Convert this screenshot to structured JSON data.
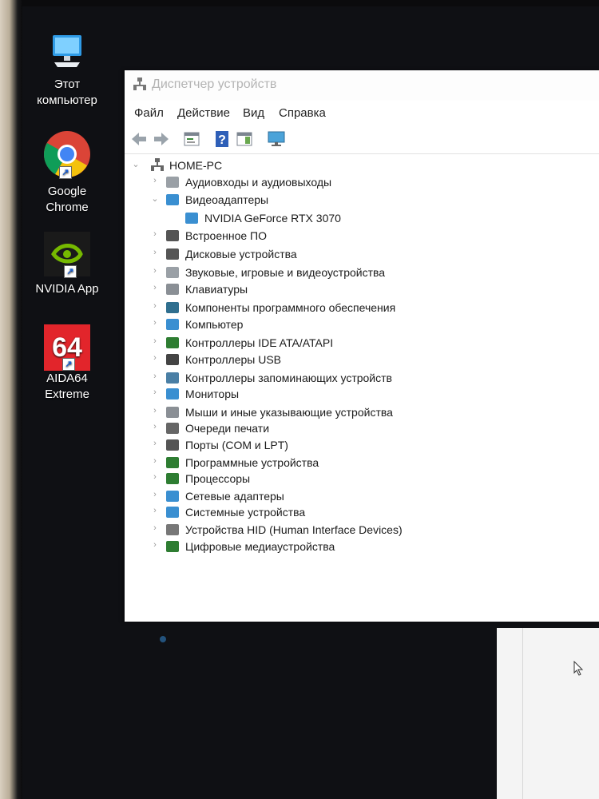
{
  "desktop": {
    "icons": [
      {
        "label1": "Этот",
        "label2": "компьютер"
      },
      {
        "label1": "Google",
        "label2": "Chrome"
      },
      {
        "label1": "NVIDIA App",
        "label2": ""
      },
      {
        "label1": "AIDA64",
        "label2": "Extreme",
        "logo_text": "64"
      }
    ]
  },
  "window": {
    "title": "Диспетчер устройств",
    "menu": [
      "Файл",
      "Действие",
      "Вид",
      "Справка"
    ],
    "toolbar_icons": [
      "back-icon",
      "forward-icon",
      "properties-icon",
      "help-icon",
      "view-icon",
      "monitor-icon"
    ]
  },
  "tree": {
    "root": "HOME-PC",
    "items": [
      {
        "label": "Аудиовходы и аудиовыходы",
        "icon": "speaker-icon",
        "expanded": false
      },
      {
        "label": "Видеоадаптеры",
        "icon": "display-adapter-icon",
        "expanded": true
      },
      {
        "label": "NVIDIA GeForce RTX 3070",
        "icon": "gpu-icon",
        "child": true
      },
      {
        "label": "Встроенное ПО",
        "icon": "firmware-icon",
        "expanded": false
      },
      {
        "label": "Дисковые устройства",
        "icon": "disk-icon",
        "expanded": false
      },
      {
        "label": "Звуковые, игровые и видеоустройства",
        "icon": "sound-icon",
        "expanded": false
      },
      {
        "label": "Клавиатуры",
        "icon": "keyboard-icon",
        "expanded": false
      },
      {
        "label": "Компоненты программного обеспечения",
        "icon": "software-component-icon",
        "expanded": false
      },
      {
        "label": "Компьютер",
        "icon": "computer-icon",
        "expanded": false
      },
      {
        "label": "Контроллеры IDE ATA/ATAPI",
        "icon": "ide-icon",
        "expanded": false
      },
      {
        "label": "Контроллеры USB",
        "icon": "usb-icon",
        "expanded": false
      },
      {
        "label": "Контроллеры запоминающих устройств",
        "icon": "storage-controller-icon",
        "expanded": false
      },
      {
        "label": "Мониторы",
        "icon": "monitor-icon",
        "expanded": false
      },
      {
        "label": "Мыши и иные указывающие устройства",
        "icon": "mouse-icon",
        "expanded": false
      },
      {
        "label": "Очереди печати",
        "icon": "printer-icon",
        "expanded": false
      },
      {
        "label": "Порты (COM и LPT)",
        "icon": "port-icon",
        "expanded": false
      },
      {
        "label": "Программные устройства",
        "icon": "software-device-icon",
        "expanded": false
      },
      {
        "label": "Процессоры",
        "icon": "processor-icon",
        "expanded": false
      },
      {
        "label": "Сетевые адаптеры",
        "icon": "network-icon",
        "expanded": false
      },
      {
        "label": "Системные устройства",
        "icon": "system-icon",
        "expanded": false
      },
      {
        "label": "Устройства HID (Human Interface Devices)",
        "icon": "hid-icon",
        "expanded": false
      },
      {
        "label": "Цифровые медиаустройства",
        "icon": "media-icon",
        "expanded": false
      }
    ]
  }
}
